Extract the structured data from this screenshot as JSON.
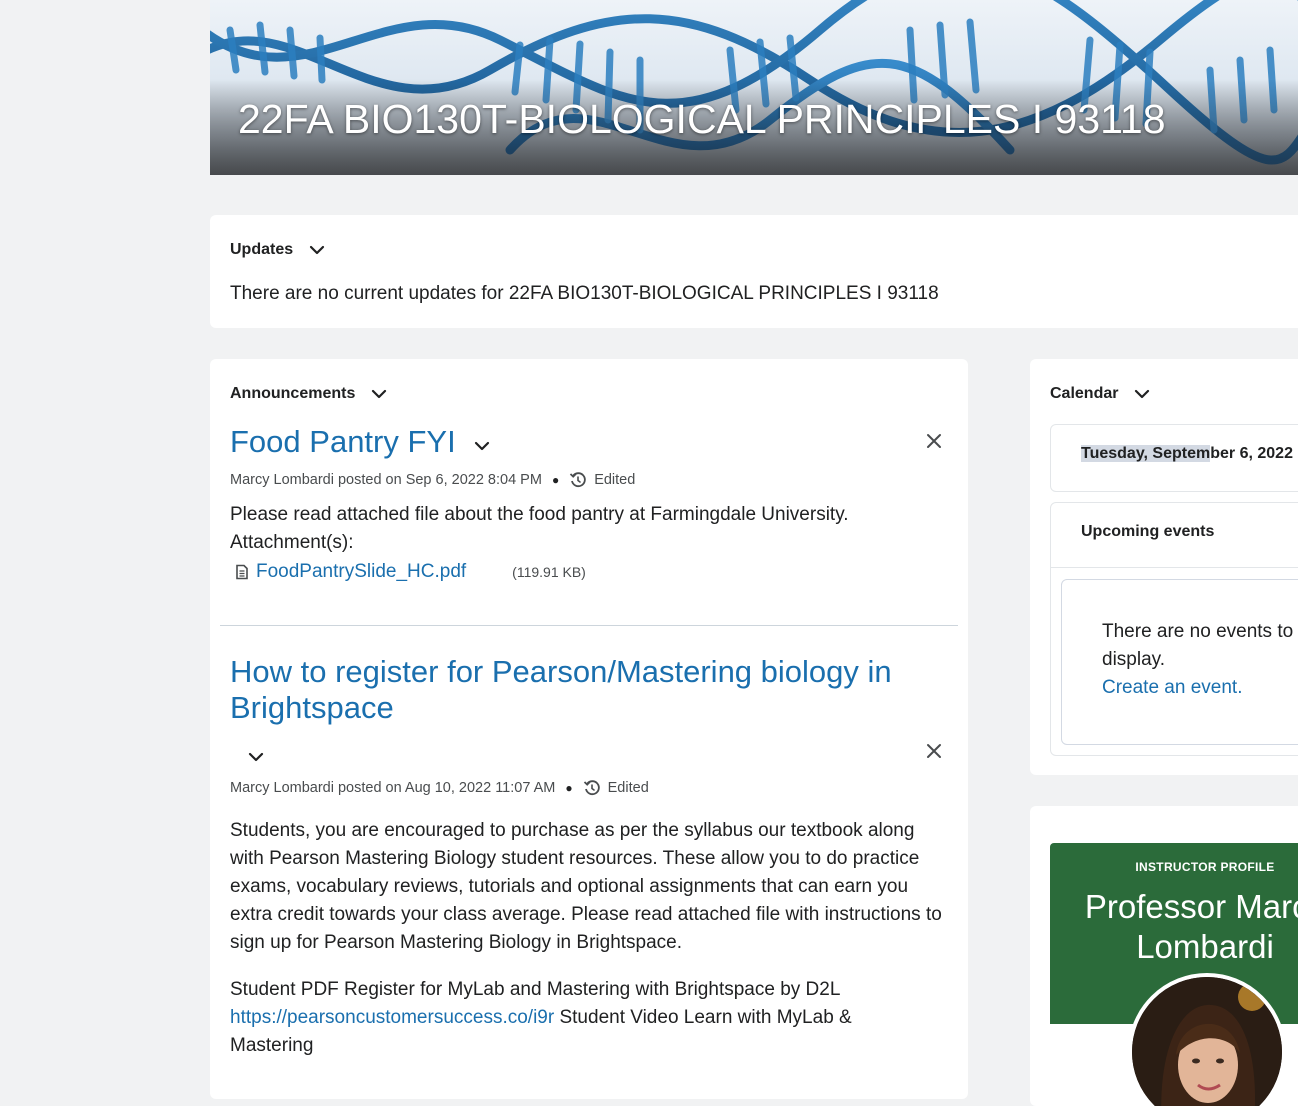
{
  "course": {
    "title": "22FA BIO130T-BIOLOGICAL PRINCIPLES I 93118"
  },
  "updates": {
    "heading": "Updates",
    "empty_text": "There are no current updates for 22FA BIO130T-BIOLOGICAL PRINCIPLES I 93118"
  },
  "announcements": {
    "heading": "Announcements",
    "items": [
      {
        "title": "Food Pantry FYI",
        "byline": "Marcy Lombardi posted on Sep 6, 2022 8:04 PM",
        "edited_label": "Edited",
        "body": "Please read attached file about the food pantry at Farmingdale University.",
        "attachments_label": "Attachment(s):",
        "attachment_name": "FoodPantrySlide_HC.pdf",
        "attachment_size": "(119.91 KB)"
      },
      {
        "title_line1": "How to register for Pearson/Mastering biology in",
        "title_line2": "Brightspace",
        "byline": "Marcy Lombardi posted on Aug 10, 2022 11:07 AM",
        "edited_label": "Edited",
        "body_lines": [
          "Students, you are encouraged to purchase as per the syllabus our textbook along",
          "with Pearson Mastering Biology student resources. These allow you to do practice",
          "exams, vocabulary reviews, tutorials and optional assignments that can earn you",
          "extra credit towards your class average. Please read attached file with instructions to",
          "sign up for Pearson Mastering Biology in Brightspace."
        ],
        "body2_line1": "Student PDF Register for MyLab and Mastering with Brightspace by D2L",
        "link_text": "https://pearsoncustomersuccess.co/i9r",
        "body2_after_link": " Student Video Learn with MyLab &",
        "body2_line3": "Mastering"
      }
    ]
  },
  "calendar": {
    "heading": "Calendar",
    "date_highlighted": "Tuesday, Septem",
    "date_rest": "ber 6, 2022",
    "upcoming_heading": "Upcoming events",
    "empty_line1": "There are no events to",
    "empty_line2": "display.",
    "create_link": "Create an event."
  },
  "profile": {
    "kicker": "INSTRUCTOR PROFILE",
    "name_line1": "Professor Marcy",
    "name_line2": "Lombardi"
  },
  "colors": {
    "link": "#1a6fae",
    "profile_green": "#2b6b3a",
    "page_bg": "#f1f2f3"
  },
  "icons": [
    "chevron-down-icon",
    "close-icon",
    "history-icon",
    "file-icon"
  ]
}
